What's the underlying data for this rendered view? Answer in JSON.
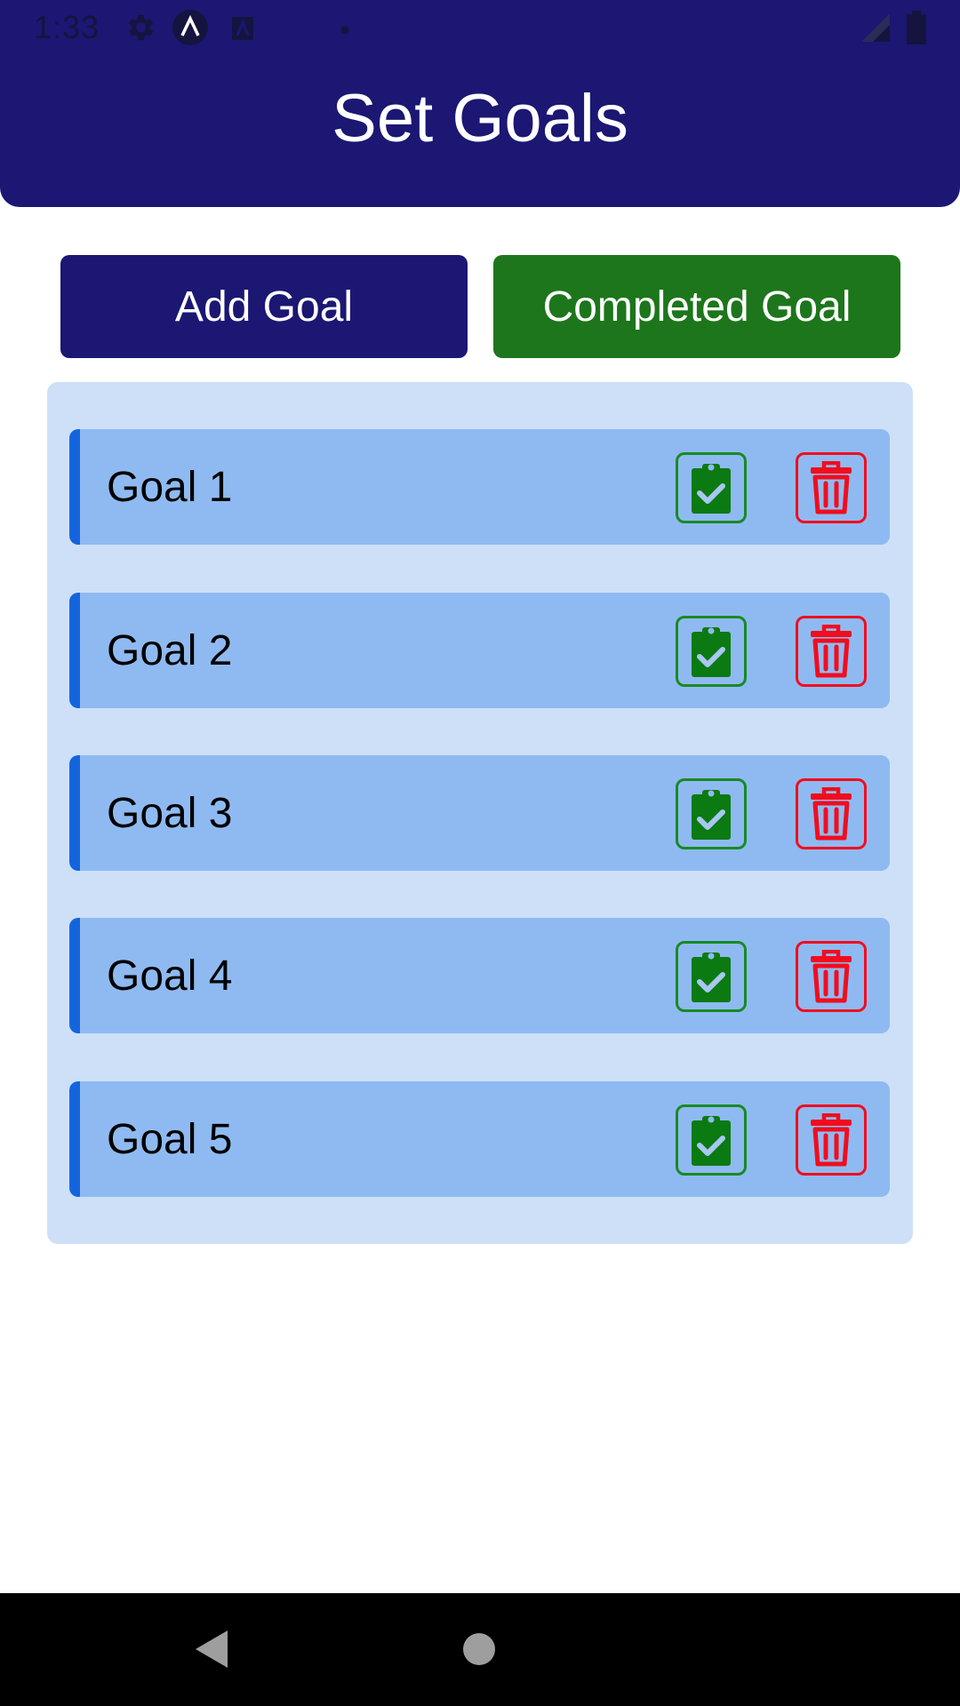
{
  "status_bar": {
    "time": "1:33",
    "icons": [
      "gear-icon",
      "app-a-icon",
      "sim-icon",
      "dot-icon",
      "signal-icon",
      "battery-icon"
    ]
  },
  "header": {
    "title": "Set Goals",
    "background": "#1b1773"
  },
  "actions": {
    "add_goal_label": "Add Goal",
    "completed_goal_label": "Completed Goal",
    "add_color": "#1b1773",
    "completed_color": "#1d761b"
  },
  "goals": [
    {
      "label": "Goal 1"
    },
    {
      "label": "Goal 2"
    },
    {
      "label": "Goal 3"
    },
    {
      "label": "Goal 4"
    },
    {
      "label": "Goal 5"
    }
  ],
  "goal_item_icons": {
    "complete": "clipboard-check-icon",
    "delete": "trash-icon",
    "complete_color": "#188a23",
    "delete_color": "#f10d1e"
  },
  "colors": {
    "panel": "#cde0f8",
    "card": "#8fbaf1",
    "card_accent": "#1465dd"
  },
  "nav_bar": {
    "icons": [
      "back-icon",
      "home-icon"
    ]
  }
}
